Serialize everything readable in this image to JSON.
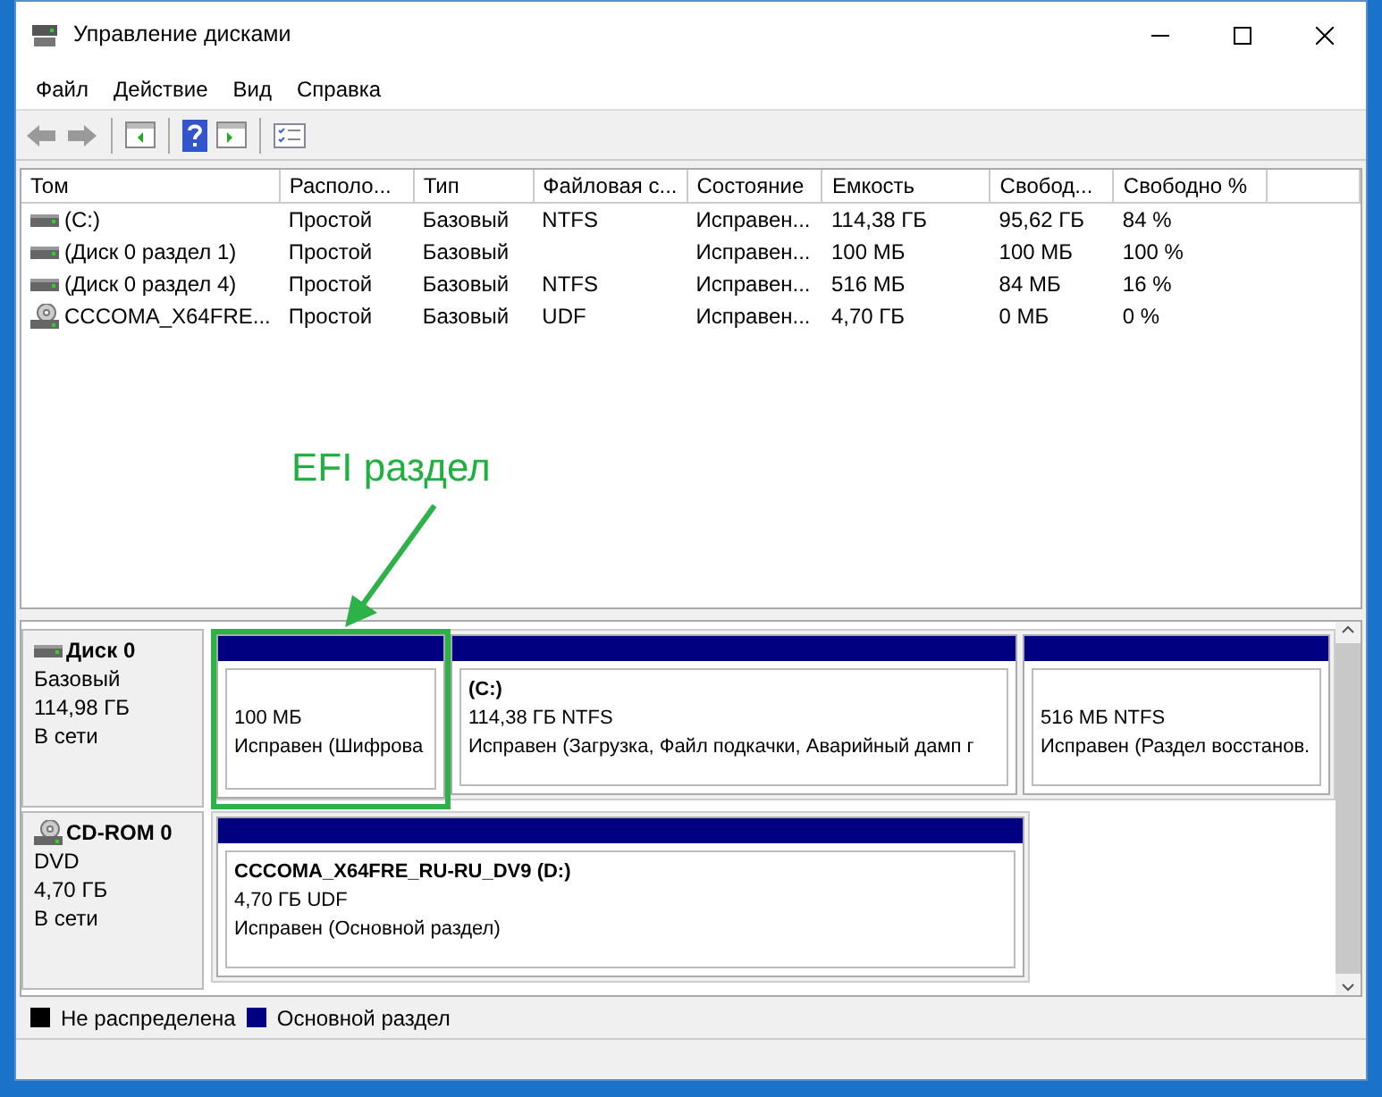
{
  "window": {
    "title": "Управление дисками"
  },
  "menu": [
    "Файл",
    "Действие",
    "Вид",
    "Справка"
  ],
  "volumes": {
    "columns": [
      "Том",
      "Располо...",
      "Тип",
      "Файловая с...",
      "Состояние",
      "Емкость",
      "Свобод...",
      "Свободно %"
    ],
    "rows": [
      {
        "kind": "disk",
        "cells": [
          "(C:)",
          "Простой",
          "Базовый",
          "NTFS",
          "Исправен...",
          "114,38 ГБ",
          "95,62 ГБ",
          "84 %"
        ]
      },
      {
        "kind": "disk",
        "cells": [
          "(Диск 0 раздел 1)",
          "Простой",
          "Базовый",
          "",
          "Исправен...",
          "100 МБ",
          "100 МБ",
          "100 %"
        ]
      },
      {
        "kind": "disk",
        "cells": [
          "(Диск 0 раздел 4)",
          "Простой",
          "Базовый",
          "NTFS",
          "Исправен...",
          "516 МБ",
          "84 МБ",
          "16 %"
        ]
      },
      {
        "kind": "cdrom",
        "cells": [
          "CCCOMA_X64FRE...",
          "Простой",
          "Базовый",
          "UDF",
          "Исправен...",
          "4,70 ГБ",
          "0 МБ",
          "0 %"
        ]
      }
    ]
  },
  "annotation": {
    "text": "EFI раздел"
  },
  "disks": [
    {
      "kind": "disk",
      "name": "Диск 0",
      "type": "Базовый",
      "size": "114,98 ГБ",
      "status": "В сети",
      "partitions": [
        {
          "size": "100 МБ",
          "status": "Исправен (Шифрова",
          "highlighted": true
        },
        {
          "title": "(C:)",
          "size": "114,38 ГБ NTFS",
          "status": "Исправен (Загрузка, Файл подкачки, Аварийный дамп г",
          "highlighted": false
        },
        {
          "size": "516 МБ NTFS",
          "status": "Исправен (Раздел восстанов.",
          "highlighted": false
        }
      ]
    },
    {
      "kind": "cdrom",
      "name": "CD-ROM 0",
      "type": "DVD",
      "size": "4,70 ГБ",
      "status": "В сети",
      "partitions": [
        {
          "title": "CCCOMA_X64FRE_RU-RU_DV9  (D:)",
          "size": "4,70 ГБ UDF",
          "status": "Исправен (Основной раздел)",
          "highlighted": false
        }
      ]
    }
  ],
  "legend": [
    {
      "label": "Не распределена",
      "color": "#000000"
    },
    {
      "label": "Основной раздел",
      "color": "#000080"
    }
  ]
}
